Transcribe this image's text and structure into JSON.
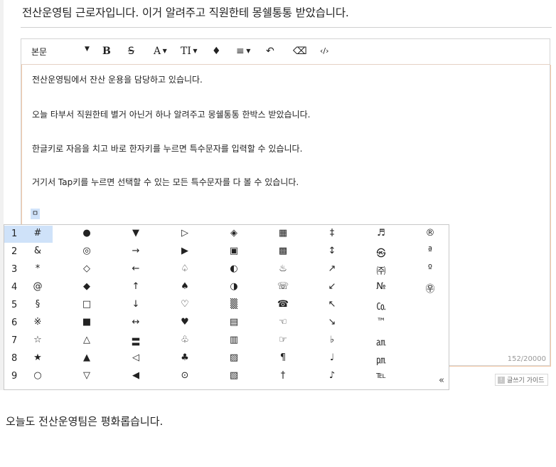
{
  "title": "전산운영팀 근로자입니다. 이거 알려주고 직원한테 몽쉘통통 받았습니다.",
  "toolbar": {
    "format_select": "본문",
    "bold": "B",
    "strike": "S",
    "font_color": "A",
    "font_size": "TI",
    "highlight": "♦",
    "align": "≡",
    "undo": "↶",
    "eraser": "⌫",
    "code": "‹/›"
  },
  "content": {
    "paragraphs": [
      "전산운영팀에서 잔산 운용을 담당하고 있습니다.",
      "오늘 타부서 직원한테 별거 아닌거 하나 알려주고 몽쉘통통 한박스 받았습니다.",
      "한글키로 자음을 치고 바로 한자키를 누르면 특수문자를 입력할 수 있습니다.",
      "거기서 Tap키를 누르면 선택할 수 있는 모든 특수문자를 다 볼 수 있습니다."
    ],
    "typed_char": "ㅁ",
    "counter": "152/20000"
  },
  "guide_label": "글쓰기 가이드",
  "popup": {
    "rows": [
      {
        "num": "1",
        "symbols": [
          "#",
          "●",
          "▼",
          "▷",
          "◈",
          "▦",
          "‡",
          "♬",
          "®"
        ]
      },
      {
        "num": "2",
        "symbols": [
          "&",
          "◎",
          "→",
          "▶",
          "▣",
          "▩",
          "↕",
          "㉿",
          "ª"
        ]
      },
      {
        "num": "3",
        "symbols": [
          "*",
          "◇",
          "←",
          "♤",
          "◐",
          "♨",
          "↗",
          "㈜",
          "º"
        ]
      },
      {
        "num": "4",
        "symbols": [
          "@",
          "◆",
          "↑",
          "♠",
          "◑",
          "☏",
          "↙",
          "№",
          "㉾"
        ]
      },
      {
        "num": "5",
        "symbols": [
          "§",
          "□",
          "↓",
          "♡",
          "▒",
          "☎",
          "↖",
          "㏇",
          ""
        ]
      },
      {
        "num": "6",
        "symbols": [
          "※",
          "■",
          "↔",
          "♥",
          "▤",
          "☜",
          "↘",
          "™",
          ""
        ]
      },
      {
        "num": "7",
        "symbols": [
          "☆",
          "△",
          "〓",
          "♧",
          "▥",
          "☞",
          "♭",
          "㏂",
          ""
        ]
      },
      {
        "num": "8",
        "symbols": [
          "★",
          "▲",
          "◁",
          "♣",
          "▨",
          "¶",
          "♩",
          "㏘",
          ""
        ]
      },
      {
        "num": "9",
        "symbols": [
          "○",
          "▽",
          "◀",
          "⊙",
          "▧",
          "†",
          "♪",
          "℡",
          ""
        ]
      }
    ],
    "more": "«"
  },
  "footer": "오늘도 전산운영팀은 평화롭습니다."
}
